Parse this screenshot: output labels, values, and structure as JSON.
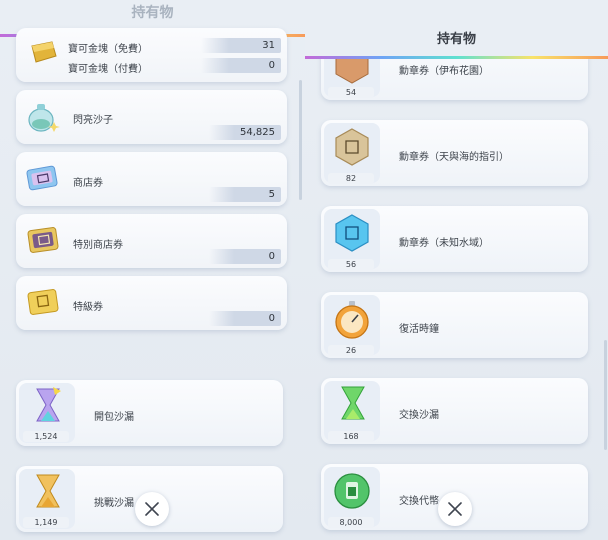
{
  "left": {
    "title": "持有物",
    "gold": {
      "free_label": "寶可金塊（免費）",
      "free_count": "31",
      "paid_label": "寶可金塊（付費）",
      "paid_count": "0"
    },
    "items": [
      {
        "label": "閃亮沙子",
        "count": "54,825",
        "icon": "shiny-sand-icon"
      },
      {
        "label": "商店券",
        "count": "5",
        "icon": "shop-ticket-icon"
      },
      {
        "label": "特別商店券",
        "count": "0",
        "icon": "special-shop-ticket-icon"
      },
      {
        "label": "特級券",
        "count": "0",
        "icon": "premium-ticket-icon"
      }
    ],
    "hourglasses": [
      {
        "label": "開包沙漏",
        "count": "1,524"
      },
      {
        "label": "挑戰沙漏",
        "count": "1,149"
      }
    ]
  },
  "right": {
    "title": "持有物",
    "items": [
      {
        "label": "勳章券（伊布花園）",
        "count": "54"
      },
      {
        "label": "勳章券（天與海的指引）",
        "count": "82"
      },
      {
        "label": "勳章券（未知水域）",
        "count": "56"
      },
      {
        "label": "復活時鐘",
        "count": "26"
      },
      {
        "label": "交換沙漏",
        "count": "168"
      },
      {
        "label": "交換代幣",
        "count": "8,000"
      }
    ]
  },
  "close_icon": "close-icon"
}
